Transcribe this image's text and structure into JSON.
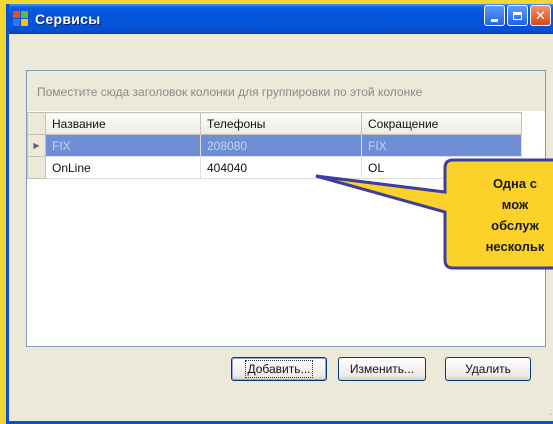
{
  "window": {
    "title": "Сервисы"
  },
  "grid": {
    "group_panel_text": "Поместите сюда заголовок колонки для группировки по этой колонке",
    "columns": [
      "Название",
      "Телефоны",
      "Сокращение"
    ],
    "rows": [
      {
        "name": "FIX",
        "phones": "208080",
        "abbr": "FIX",
        "selected": true
      },
      {
        "name": "OnLine",
        "phones": "404040",
        "abbr": "OL",
        "selected": false
      }
    ],
    "row_indicator": "▶"
  },
  "buttons": {
    "add": "Добавить...",
    "edit": "Изменить...",
    "delete": "Удалить"
  },
  "callout": {
    "lines": [
      "Одна с",
      "мож",
      "обслуж",
      "нескольк"
    ],
    "fill_color": "#fbd12a",
    "border_color": "#3b3f9e"
  },
  "colors": {
    "titlebar": "#0454da",
    "selected_row": "#6e8fd5",
    "desktop_background": "#f2d633"
  }
}
